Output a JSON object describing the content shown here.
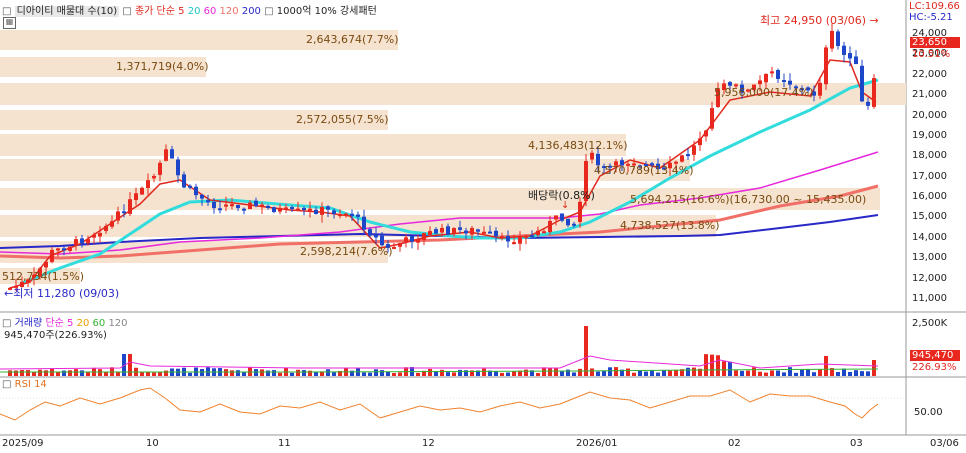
{
  "header": {
    "checkbox_symbol": "□",
    "title": "디아이티 매물대 수(10)",
    "ma_label": "종가 단순",
    "ma_periods": [
      "5",
      "20",
      "60",
      "120",
      "200"
    ],
    "pattern": "1000억 10% 강세패턴"
  },
  "right_info": {
    "lc": "LC:109.66",
    "hc": "HC:-5.21"
  },
  "price_panel": {
    "high_label": "최고 24,950 (03/06)",
    "low_label": "최저 11,280 (09/03)",
    "dividend_label": "배당락(0.8%)",
    "current_price": "23,650",
    "current_pct": "10.51%",
    "y_ticks": [
      "24,000",
      "23,000",
      "22,000",
      "21,000",
      "20,000",
      "19,000",
      "18,000",
      "17,000",
      "16,000",
      "15,000",
      "14,000",
      "13,000",
      "12,000",
      "11,000"
    ]
  },
  "volume_profile": [
    {
      "label": "2,643,674(7.7%)"
    },
    {
      "label": "1,371,719(4.0%)"
    },
    {
      "label": "5,956,000(17.4%)"
    },
    {
      "label": "2,572,055(7.5%)"
    },
    {
      "label": "4,136,483(12.1%)"
    },
    {
      "label": "4,570,789(13.4%)"
    },
    {
      "label": "5,694,215(16.6%)(16,730.00 ~ 15,435.00)"
    },
    {
      "label": "4,738,527(13.8%)"
    },
    {
      "label": "2,598,214(7.6%)"
    },
    {
      "label": "512,734(1.5%)"
    }
  ],
  "volume_panel": {
    "title": "거래량",
    "ma_label": "단순",
    "ma_periods": [
      "5",
      "20",
      "60",
      "120"
    ],
    "summary": "945,470주(226.93%)",
    "y_tick": "2,500K",
    "current_value": "945,470",
    "current_pct": "226.93%"
  },
  "rsi_panel": {
    "title": "RSI 14",
    "y_tick": "50.00"
  },
  "x_axis": [
    "2025/09",
    "10",
    "11",
    "12",
    "2026/01",
    "02",
    "03",
    "03/06"
  ],
  "colors": {
    "up": "#e8281e",
    "down": "#1e46c8",
    "ma5": "#e0281e",
    "ma20": "#32dcdc",
    "ma60": "#e628dc",
    "ma120": "#f07068",
    "ma200": "#2828c8",
    "profile": "#f5e3cf",
    "profile_highlight": "#f0d0b0"
  },
  "chart_data": {
    "type": "candlestick",
    "ylim": [
      10500,
      25300
    ],
    "x_labels": [
      "2025/09",
      "10",
      "11",
      "12",
      "2026/01",
      "02",
      "03"
    ],
    "summary": {
      "high": 24950,
      "high_date": "03/06",
      "low": 11280,
      "low_date": "09/03",
      "last_close": 23650
    },
    "volume_profile_bins": [
      {
        "volume": 2643674,
        "pct": 7.7
      },
      {
        "volume": 1371719,
        "pct": 4.0
      },
      {
        "volume": 5956000,
        "pct": 17.4
      },
      {
        "volume": 2572055,
        "pct": 7.5
      },
      {
        "volume": 4136483,
        "pct": 12.1
      },
      {
        "volume": 4570789,
        "pct": 13.4
      },
      {
        "volume": 5694215,
        "pct": 16.6,
        "range": [
          15435,
          16730
        ]
      },
      {
        "volume": 4738527,
        "pct": 13.8
      },
      {
        "volume": 2598214,
        "pct": 7.6
      },
      {
        "volume": 512734,
        "pct": 1.5
      }
    ],
    "last_volume": 945470,
    "last_volume_pct": 226.93
  }
}
